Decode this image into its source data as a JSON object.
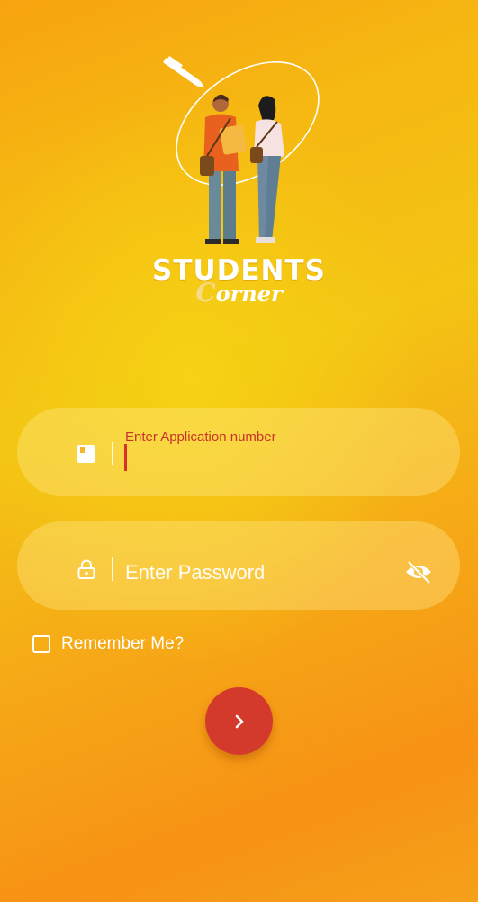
{
  "brand": {
    "line1": "STUDENTS",
    "line2_first": "C",
    "line2_rest": "orner"
  },
  "login": {
    "application_label": "Enter Application number",
    "application_value": "",
    "password_placeholder": "Enter Password",
    "remember_label": "Remember Me?",
    "remember_checked": false
  },
  "icons": {
    "application": "card-icon",
    "password": "lock-icon",
    "visibility": "eye-off-icon",
    "submit": "chevron-right-icon"
  },
  "colors": {
    "accent": "#d33a2c",
    "label_error": "#c8322c",
    "background_top": "#f7a410",
    "background_mid": "#f3c414",
    "background_bottom": "#f79215"
  }
}
